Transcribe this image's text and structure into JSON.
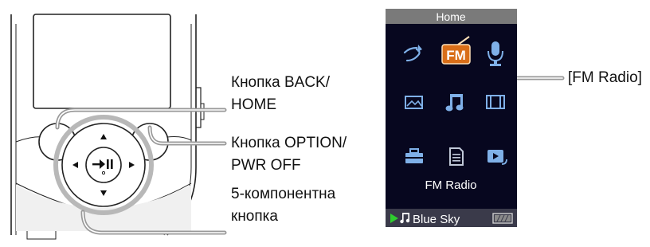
{
  "labels": {
    "back_line1": "Кнопка BACK/",
    "back_line2": "HOME",
    "option_line1": "Кнопка OPTION/",
    "option_line2": "PWR OFF",
    "fiveway_line1": "5-компонентна",
    "fiveway_line2": "кнопка",
    "fm_radio_callout": "[FM Radio]"
  },
  "screen": {
    "header_title": "Home",
    "selected_label": "FM Radio",
    "fm_icon_text": "FM",
    "now_playing": "Blue Sky",
    "icons": [
      "shuffle-icon",
      "fm-radio-icon",
      "microphone-icon",
      "photo-icon",
      "music-note-icon",
      "video-icon",
      "settings-icon",
      "document-icon",
      "now-playing-icon"
    ]
  },
  "colors": {
    "screen_bg": "#07071f",
    "header_bg": "#7a7a7a",
    "accent_orange": "#e07a1e",
    "status_bar": "#3a3a4a",
    "play_green": "#2ecc2e"
  }
}
